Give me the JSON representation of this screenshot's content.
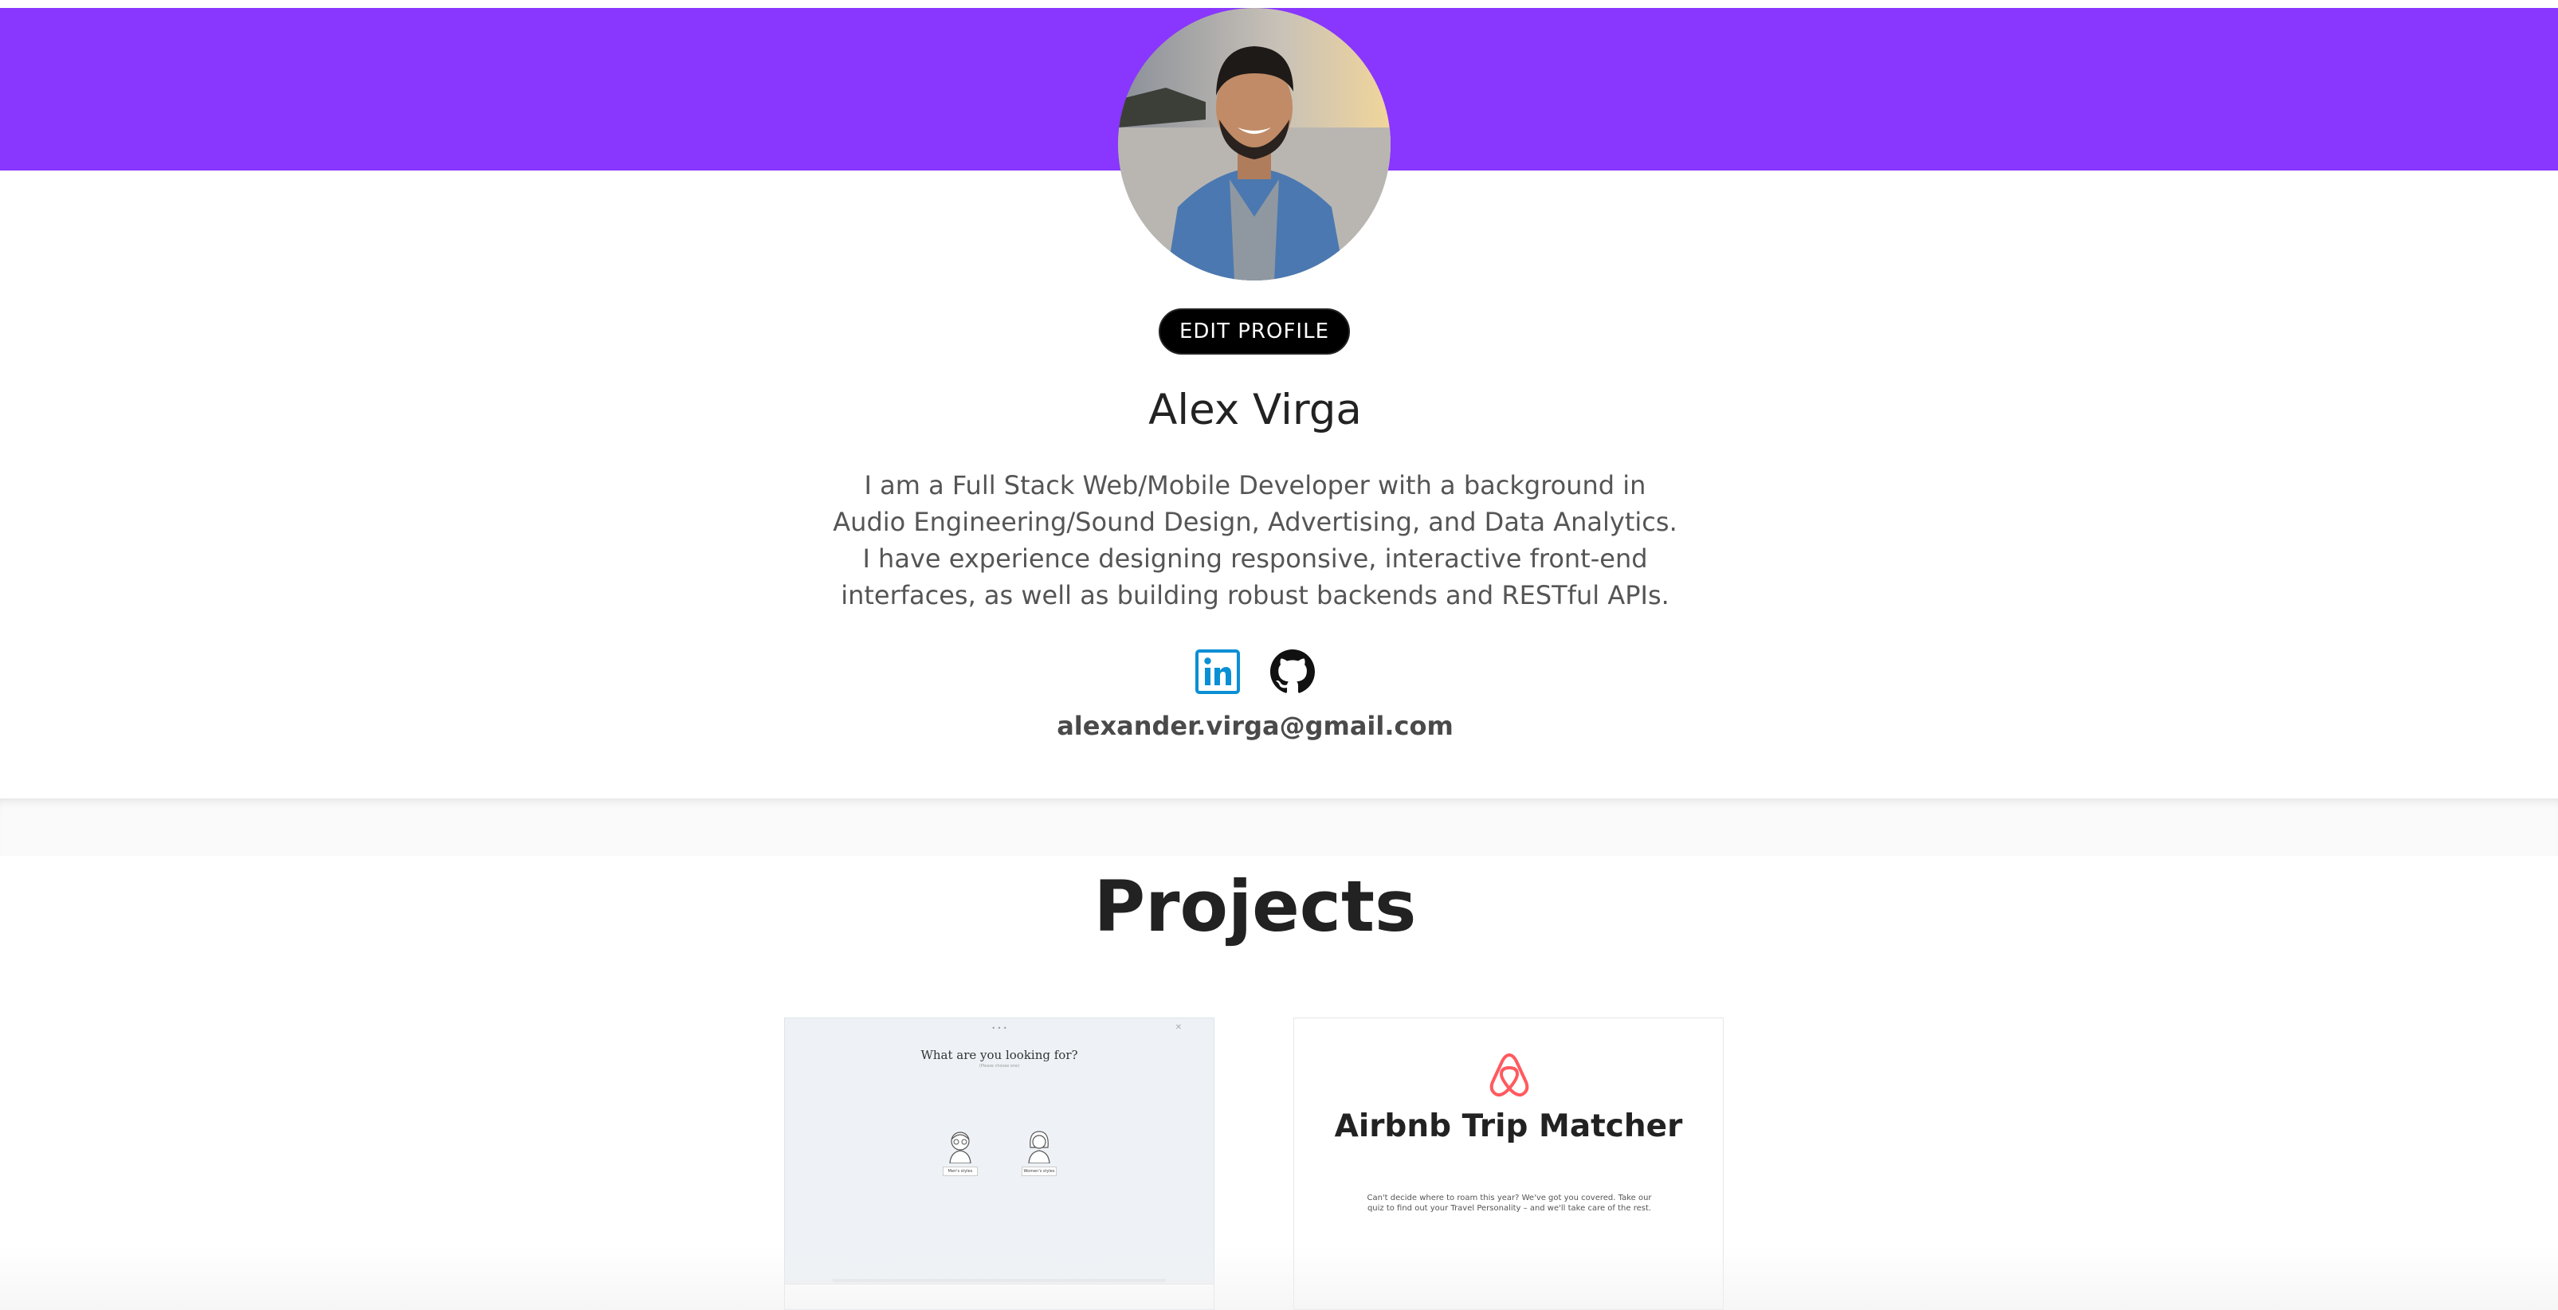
{
  "colors": {
    "banner": "#8936fe",
    "linkedin": "#0a8fd4",
    "airbnb": "#ff5a5f",
    "edit_button_bg": "#000000"
  },
  "profile": {
    "edit_label": "EDIT PROFILE",
    "name": "Alex Virga",
    "bio": "I am a Full Stack Web/Mobile Developer with a background in Audio Engineering/Sound Design, Advertising, and Data Analytics. I have experience designing responsive, interactive front-end interfaces, as well as building robust backends and RESTful APIs.",
    "email": "alexander.virga@gmail.com",
    "social": [
      {
        "icon": "linkedin-icon"
      },
      {
        "icon": "github-icon"
      }
    ]
  },
  "projects": {
    "title": "Projects",
    "cards": [
      {
        "title": "What are you looking for?",
        "subtitle": "(Please choose one)",
        "options": [
          "Men's styles",
          "Women's styles"
        ]
      },
      {
        "icon": "airbnb-logo-icon",
        "title": "Airbnb Trip Matcher",
        "description": "Can't decide where to roam this year? We've got you covered. Take our quiz to find out your Travel Personality – and we'll take care of the rest."
      }
    ]
  }
}
